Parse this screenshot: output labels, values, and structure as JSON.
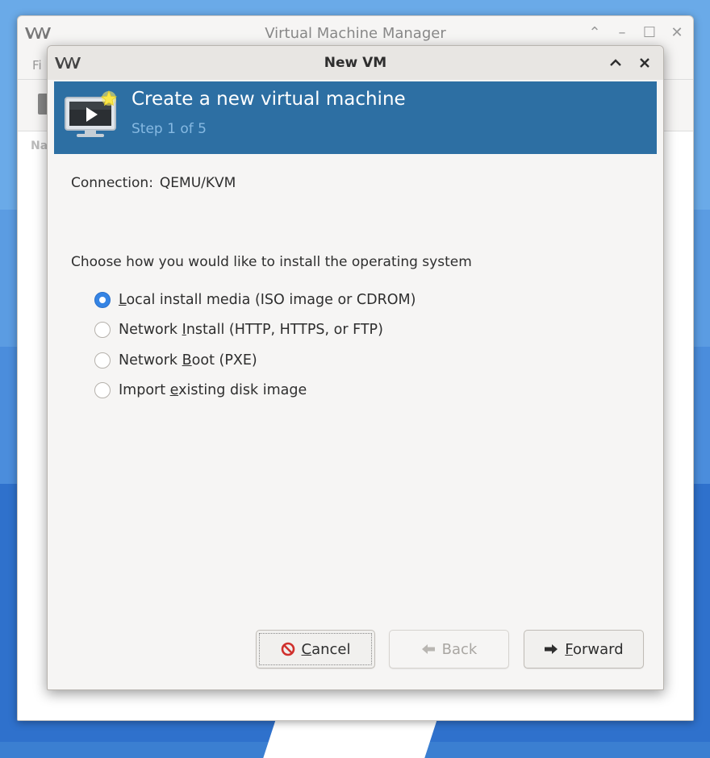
{
  "main_window": {
    "title": "Virtual Machine Manager",
    "menu_first": "Fi",
    "list_header": "Na",
    "controls": {
      "minimize_up": "⌃",
      "minimize": "—",
      "maximize": "☐",
      "close": "✕"
    }
  },
  "dialog": {
    "title": "New VM",
    "banner": {
      "title": "Create a new virtual machine",
      "step": "Step 1 of 5"
    },
    "connection": {
      "label": "Connection:",
      "value": "QEMU/KVM"
    },
    "prompt": "Choose how you would like to install the operating system",
    "options": [
      {
        "label": "Local install media (ISO image or CDROM)",
        "mnemonic_index": 0,
        "checked": true
      },
      {
        "label": "Network Install (HTTP, HTTPS, or FTP)",
        "mnemonic_index": 8,
        "checked": false
      },
      {
        "label": "Network Boot (PXE)",
        "mnemonic_index": 8,
        "checked": false
      },
      {
        "label": "Import existing disk image",
        "mnemonic_index": 7,
        "checked": false
      }
    ],
    "buttons": {
      "cancel": "Cancel",
      "back": "Back",
      "forward": "Forward"
    },
    "colors": {
      "banner_bg": "#2d6fa3",
      "radio_accent": "#3584e4"
    }
  }
}
